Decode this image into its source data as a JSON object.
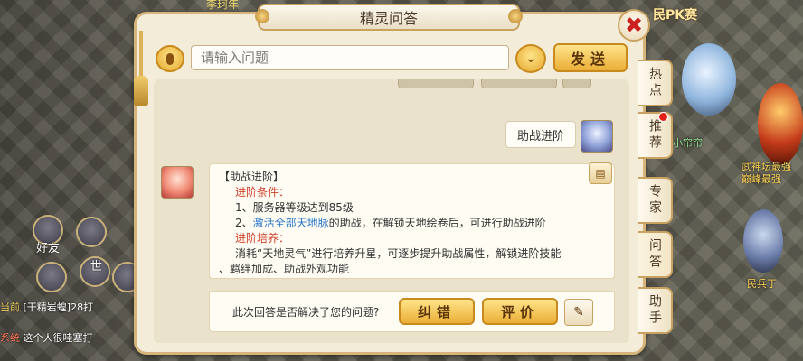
{
  "background": {
    "top_text": "李珂年",
    "pk_text": "民PK赛",
    "names": [
      "小帘帘",
      "武神坛最强",
      "巅峰最强",
      "民兵丁"
    ],
    "hud": {
      "friend_label": "好友",
      "mic_label": "世"
    },
    "chat": [
      {
        "channel": "当前",
        "text": "[干精岩蝗]28打"
      },
      {
        "channel": "系统",
        "text": "这个人很哇塞打"
      }
    ]
  },
  "dialog": {
    "title": "精灵问答",
    "close_icon": "✖",
    "input": {
      "placeholder": "请输入问题",
      "value": ""
    },
    "send_label": "发送",
    "user_question": "助战进阶",
    "answer": {
      "heading": "【助战进阶】",
      "cond_title": "进阶条件：",
      "cond_1": "1、服务器等级达到85级",
      "cond_2_prefix": "2、",
      "cond_2_link": "激活全部天地脉",
      "cond_2_suffix": "的助战，在解锁天地绘卷后，可进行助战进阶",
      "train_title": "进阶培养：",
      "train_line1": "消耗“天地灵气”进行培养升星，可逐步提升助战属性，解锁进阶技能",
      "train_line2": "、羁绊加成、助战外观功能"
    },
    "footer": {
      "question": "此次回答是否解决了您的问题?",
      "correct_label": "纠错",
      "rate_label": "评价"
    }
  },
  "side_tabs": [
    "热点",
    "推荐",
    "专家",
    "问答",
    "助手"
  ],
  "colors": {
    "accent_red": "#d2402a",
    "link_blue": "#2a78c8",
    "button_gold": "#eaae36"
  }
}
